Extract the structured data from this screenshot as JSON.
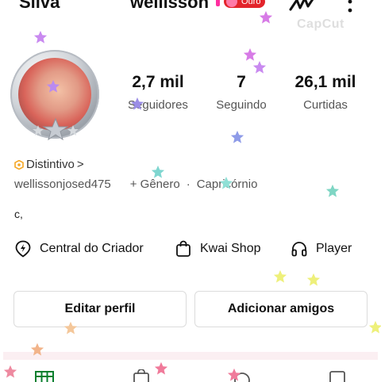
{
  "header": {
    "left_name": "Silva",
    "center_name": "wellisson",
    "badge_label": "Ouro",
    "watermark": "CapCut"
  },
  "profile": {
    "stats": [
      {
        "value": "2,7 mil",
        "label": "Seguidores"
      },
      {
        "value": "7",
        "label": "Seguindo"
      },
      {
        "value": "26,1 mil",
        "label": "Curtidas"
      }
    ],
    "distintivo_label": "Distintivo",
    "distintivo_chevron": ">",
    "username": "wellissonjosed475",
    "gender_label": "+ Gênero",
    "separator": "·",
    "zodiac": "Capricórnio",
    "bio": "c,"
  },
  "links": [
    {
      "label": "Central do Criador",
      "icon": "lightning-pin-icon"
    },
    {
      "label": "Kwai Shop",
      "icon": "shopping-bag-icon"
    },
    {
      "label": "Player",
      "icon": "headphones-icon"
    }
  ],
  "buttons": {
    "edit_profile": "Editar perfil",
    "add_friends": "Adicionar amigos"
  },
  "colors": {
    "badge_red": "#e3242b",
    "badge_orange": "#f5a623",
    "accent_pink": "#ff2fa0"
  }
}
